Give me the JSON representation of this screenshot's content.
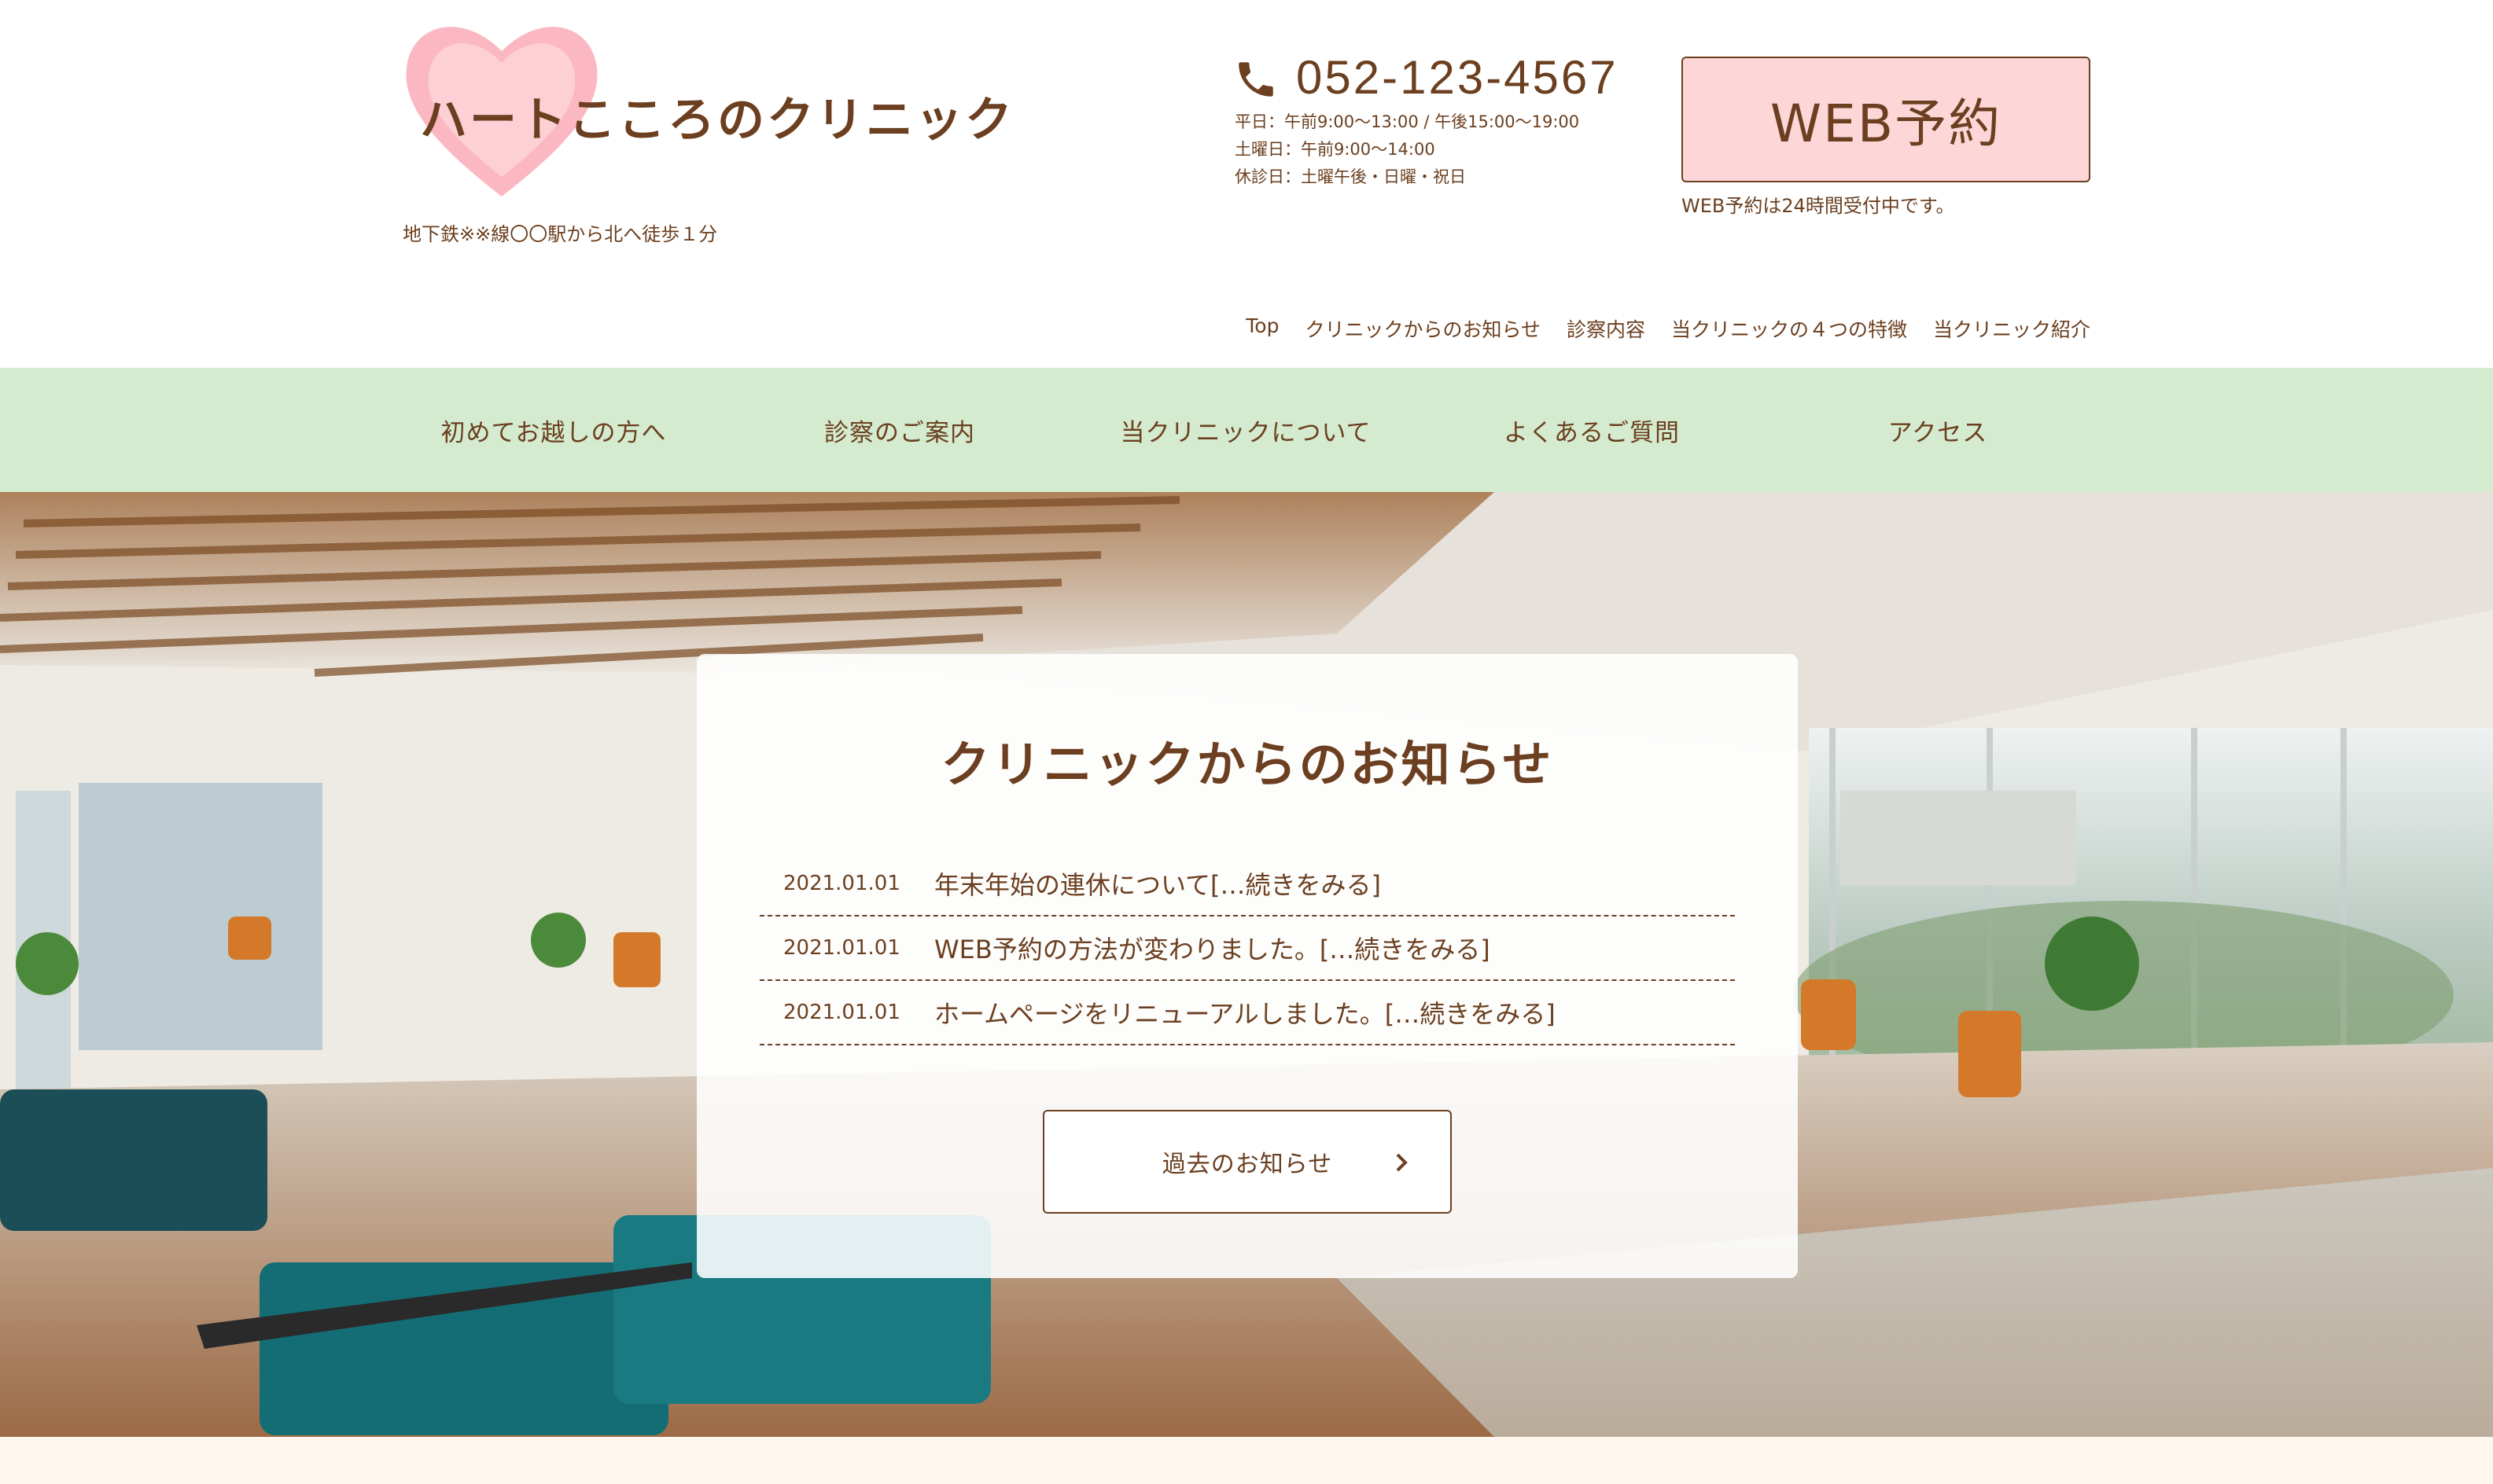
{
  "header": {
    "clinic_name": "ハートこころのクリニック",
    "access_note": "地下鉄※※線〇〇駅から北へ徒歩１分",
    "phone": "052-123-4567",
    "hours": [
      "平日：午前9:00〜13:00 / 午後15:00〜19:00",
      "土曜日：午前9:00〜14:00",
      "休診日：土曜午後・日曜・祝日"
    ],
    "web_button": "WEB予約",
    "web_note": "WEB予約は24時間受付中です。"
  },
  "top_nav": [
    "Top",
    "クリニックからのお知らせ",
    "診察内容",
    "当クリニックの４つの特徴",
    "当クリニック紹介"
  ],
  "main_nav": [
    "初めてお越しの方へ",
    "診察のご案内",
    "当クリニックについて",
    "よくあるご質問",
    "アクセス"
  ],
  "news": {
    "title": "クリニックからのお知らせ",
    "items": [
      {
        "date": "2021.01.01",
        "text": "年末年始の連休について[…続きをみる]"
      },
      {
        "date": "2021.01.01",
        "text": "WEB予約の方法が変わりました。[…続きをみる]"
      },
      {
        "date": "2021.01.01",
        "text": "ホームページをリニューアルしました。[…続きをみる]"
      }
    ],
    "past_button": "過去のお知らせ"
  },
  "icons": {
    "logo": "heart-icon",
    "phone": "phone-icon",
    "past_arrow": "chevron-right-icon"
  },
  "colors": {
    "brand_text": "#6b3f1f",
    "nav_bg": "#d4ebcf",
    "web_button_bg": "#fdd6d8",
    "heart": "#fbb8c3"
  }
}
